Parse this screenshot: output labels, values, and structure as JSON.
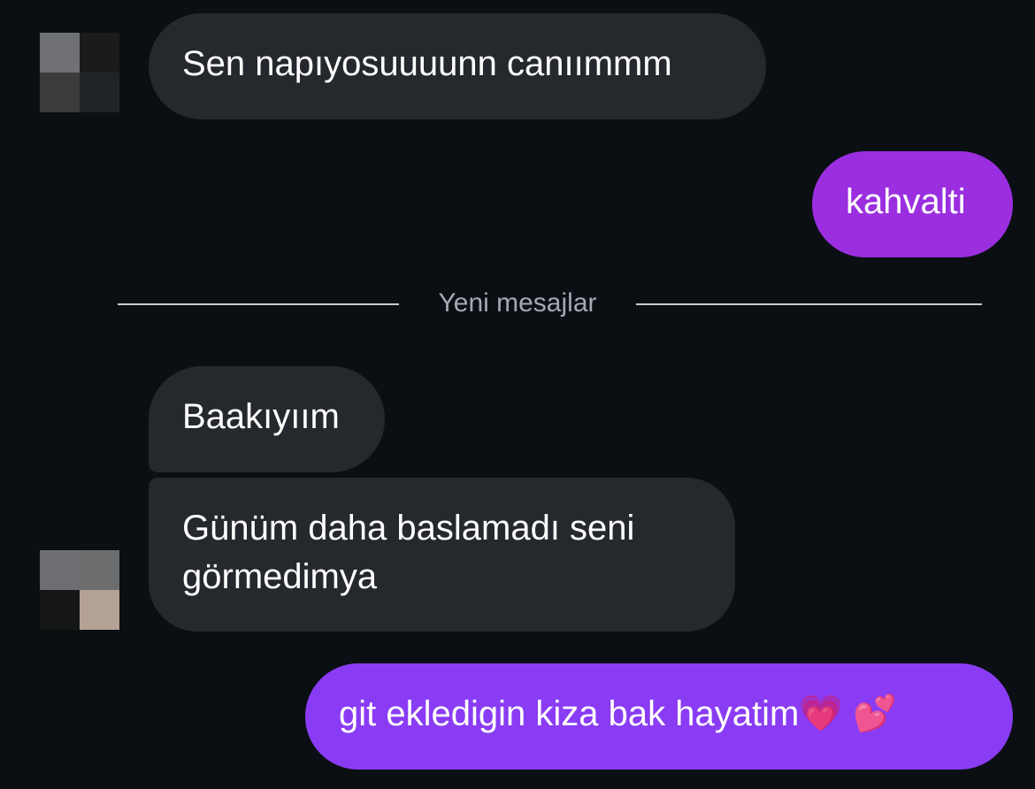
{
  "conversation": {
    "messages": [
      {
        "text": "Sen napıyosuuuunn canıımmm"
      },
      {
        "text": "kahvalti"
      },
      {
        "text": "Baakıyıım"
      },
      {
        "lines": [
          "Günüm daha baslamadı seni",
          "görmedimya"
        ]
      },
      {
        "text": "git ekledigin kiza bak hayatim💗 💕"
      }
    ],
    "divider_label": "Yeni mesajlar"
  },
  "colors": {
    "background": "#0b0f14",
    "incoming_bubble": "#25282c",
    "outgoing_bubble_1": "#9b2fe0",
    "outgoing_bubble_2": "#8a3cf4",
    "divider": "#c7ccd3"
  },
  "avatars": {
    "first": [
      "#707174",
      "#1b1b1c",
      "#3a3b3b",
      "#202426"
    ],
    "second": [
      "#6d6e71",
      "#6c6d6f",
      "#141716",
      "#b4a296"
    ]
  }
}
